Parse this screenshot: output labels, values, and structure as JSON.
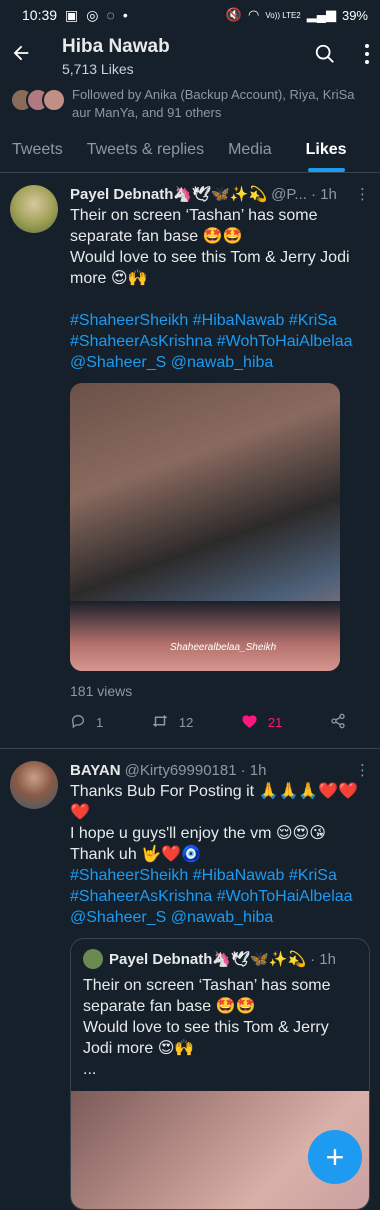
{
  "status_bar": {
    "time": "10:39",
    "battery": "39%",
    "network": "Vo)) LTE2"
  },
  "header": {
    "title": "Hiba Nawab",
    "subtitle": "5,713 Likes"
  },
  "followed_by": "Followed by Anika (Backup Account), Riya, KriSa aur ManYa, and 91 others",
  "tabs": [
    {
      "label": "Tweets"
    },
    {
      "label": "Tweets & replies"
    },
    {
      "label": "Media"
    },
    {
      "label": "Likes"
    }
  ],
  "tweets": [
    {
      "name": "Payel Debnath🦄🕊🦋✨💫",
      "handle": "@P...",
      "time": "· 1h",
      "text": "Their on screen ‘Tashan’ has some separate fan base 🤩🤩\nWould love to see this Tom & Jerry Jodi more 😍🙌",
      "hashtags": "#ShaheerSheikh #HibaNawab #KriSa #ShaheerAsKrishna #WohToHaiAlbelaa @Shaheer_S @nawab_hiba",
      "watermark": "Shaheeralbelaa_Sheikh",
      "views": "181 views",
      "replies": "1",
      "retweets": "12",
      "likes": "21"
    },
    {
      "name": "BAYAN",
      "handle": "@Kirty69990181",
      "time": "· 1h",
      "text": "Thanks Bub For Posting it 🙏🙏🙏❤️❤️❤️\nI hope u guys'll enjoy the vm 😌😍😘\nThank uh 🤟❤️🧿",
      "hashtags": "#ShaheerSheikh #HibaNawab #KriSa #ShaheerAsKrishna #WohToHaiAlbelaa @Shaheer_S @nawab_hiba",
      "quote": {
        "name": "Payel Debnath🦄🕊🦋✨💫",
        "time": "· 1h",
        "text": "Their on screen ‘Tashan’ has some separate fan base 🤩🤩\nWould love to see this Tom & Jerry Jodi more 😍🙌\n..."
      }
    }
  ],
  "fab": {
    "icon": "plus-icon",
    "label": "+"
  },
  "colors": {
    "background": "#15202b",
    "accent": "#1d9bf0",
    "like": "#f91880"
  }
}
